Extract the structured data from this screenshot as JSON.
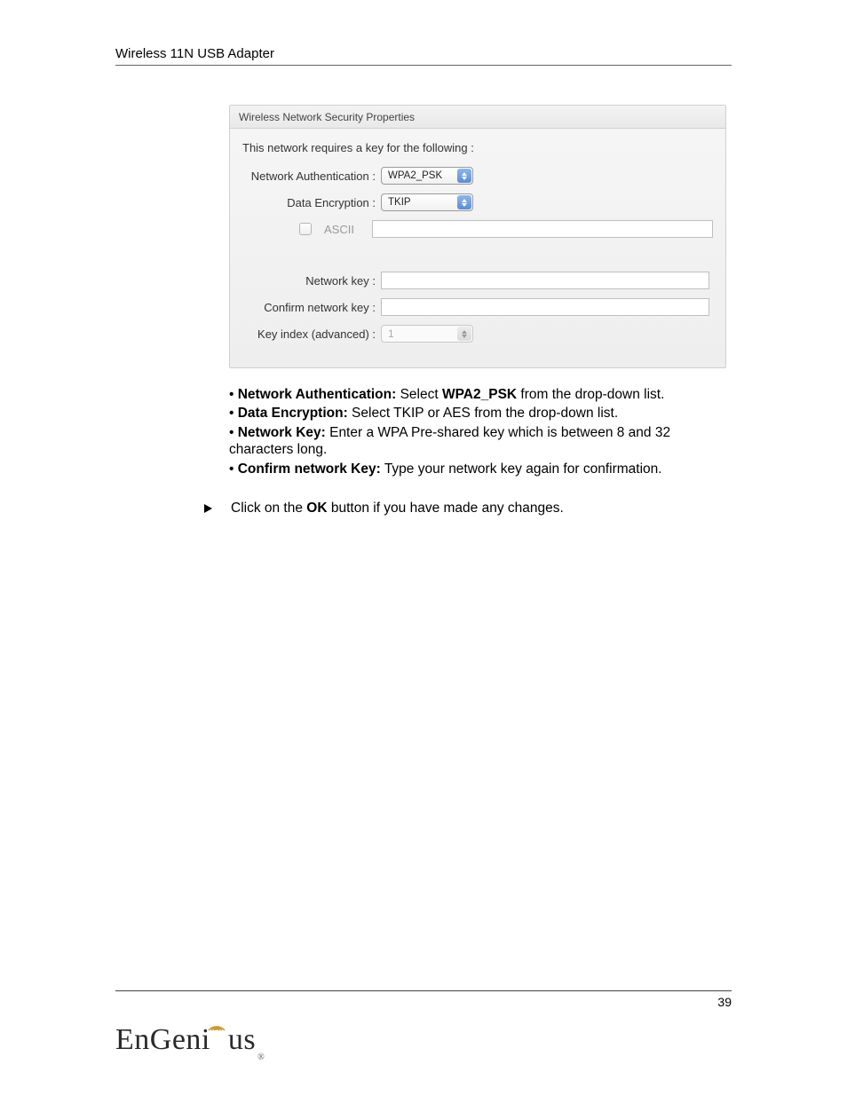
{
  "header": {
    "title": "Wireless 11N USB Adapter"
  },
  "panel": {
    "title": "Wireless Network Security Properties",
    "intro": "This network requires a key for the following :",
    "labels": {
      "network_auth": "Network Authentication :",
      "data_encryption": "Data Encryption :",
      "ascii": "ASCII",
      "network_key": "Network key :",
      "confirm_key": "Confirm network key :",
      "key_index": "Key index (advanced) :"
    },
    "values": {
      "network_auth": "WPA2_PSK",
      "data_encryption": "TKIP",
      "key_index": "1"
    }
  },
  "instructions": {
    "b1_label": "Network Authentication:",
    "b1_text": " Select ",
    "b1_bold": "WPA2_PSK",
    "b1_after": " from the drop-down list.",
    "b2_label": "Data Encryption:",
    "b2_text": " Select TKIP or AES from the drop-down list.",
    "b3_label": "Network Key:",
    "b3_text": " Enter a WPA Pre-shared key which is between 8 and 32 characters long.",
    "b4_label": "Confirm network Key:",
    "b4_text": " Type your network key again for confirmation.",
    "ok_line_pre": "Click on the ",
    "ok_bold": "OK",
    "ok_line_post": " button if you have made any changes."
  },
  "footer": {
    "page_number": "39",
    "logo_a": "EnGen",
    "logo_b": "us",
    "logo_i": "i"
  }
}
